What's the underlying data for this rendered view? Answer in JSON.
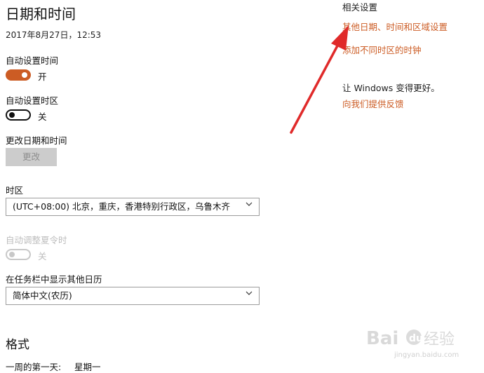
{
  "page": {
    "title": "日期和时间",
    "current_datetime": "2017年8月27日，12:53"
  },
  "settings": {
    "auto_time": {
      "label": "自动设置时间",
      "state": "开",
      "on": true
    },
    "auto_timezone": {
      "label": "自动设置时区",
      "state": "关",
      "on": false
    },
    "change_datetime": {
      "label": "更改日期和时间",
      "button": "更改"
    },
    "timezone": {
      "label": "时区",
      "value": "(UTC+08:00) 北京，重庆，香港特别行政区，乌鲁木齐"
    },
    "dst": {
      "label": "自动调整夏令时",
      "state": "关",
      "disabled": true
    },
    "calendar": {
      "label": "在任务栏中显示其他日历",
      "value": "简体中文(农历)"
    }
  },
  "format": {
    "heading": "格式",
    "first_day_label": "一周的第一天:",
    "first_day_value": "星期一"
  },
  "related": {
    "heading": "相关设置",
    "link_regional": "其他日期、时间和区域设置",
    "link_clocks": "添加不同时区的时钟"
  },
  "feedback": {
    "heading": "让 Windows 变得更好。",
    "link": "向我们提供反馈"
  },
  "watermark": {
    "text": "Baidu经验",
    "sub": "jingyan.baidu.com"
  },
  "colors": {
    "accent": "#cc5c24",
    "arrow": "#e02a2a",
    "disabled": "#cccccc"
  }
}
